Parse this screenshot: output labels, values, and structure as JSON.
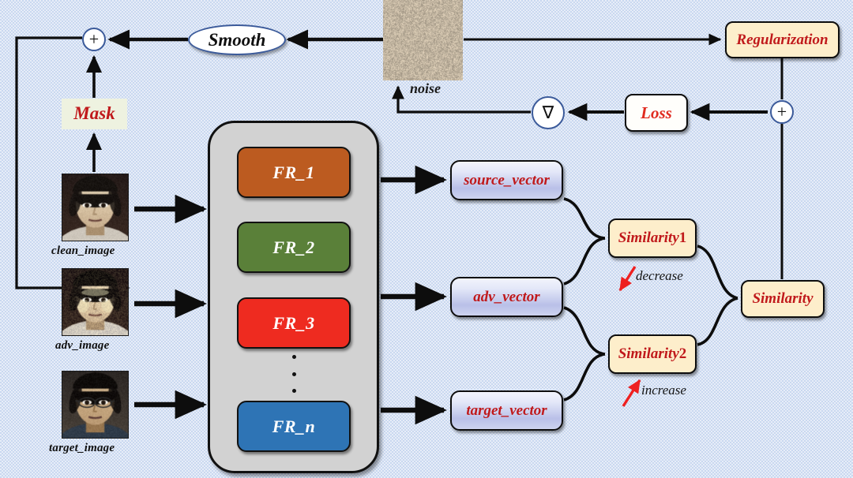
{
  "meta": {
    "title": "Adversarial face-recognition attack pipeline diagram",
    "background_color": "#c9d8f0"
  },
  "colors": {
    "cream_fill": "#fdeecb",
    "red_text": "#c0191b",
    "fr1": "#bc5b20",
    "fr2": "#5a8039",
    "fr3": "#ee2b20",
    "frn": "#2e74b5",
    "container_fill": "#d2d2d2",
    "ellipse_stroke": "#3b5a9a",
    "arrow_red": "#ee2020",
    "vector_gradient_from": "#f2f4fc",
    "vector_gradient_to": "#b9c0e8"
  },
  "nodes": {
    "plus_left": "+",
    "smooth": "Smooth",
    "noise_caption": "noise",
    "regularization": "Regularization",
    "gradient_op": "∇",
    "loss": "Loss",
    "plus_right": "+",
    "mask": "Mask",
    "similarity": "Similarity",
    "similarity1_base": "Similarity",
    "similarity1_index": "1",
    "similarity2_base": "Similarity",
    "similarity2_index": "2",
    "vertical_dots": "⋮"
  },
  "images": [
    {
      "id": "clean",
      "caption": "clean_image"
    },
    {
      "id": "adv",
      "caption": "adv_image"
    },
    {
      "id": "target",
      "caption": "target_image"
    }
  ],
  "fr_models": [
    {
      "label": "FR_1",
      "color": "#bc5b20"
    },
    {
      "label": "FR_2",
      "color": "#5a8039"
    },
    {
      "label": "FR_3",
      "color": "#ee2b20"
    },
    {
      "label": "FR_n",
      "color": "#2e74b5"
    }
  ],
  "vectors": [
    {
      "label": "source_vector"
    },
    {
      "label": "adv_vector"
    },
    {
      "label": "target_vector"
    }
  ],
  "annotations": [
    {
      "label": "decrease",
      "direction": "down"
    },
    {
      "label": "increase",
      "direction": "up"
    }
  ]
}
